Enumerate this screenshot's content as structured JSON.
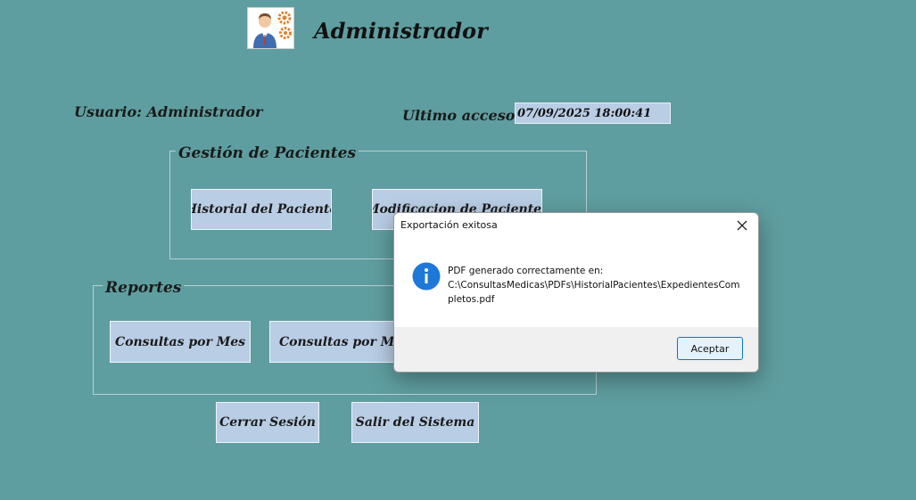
{
  "header": {
    "title": "Administrador",
    "logo_icon": "admin-gears-icon"
  },
  "user": {
    "label": "Usuario: Administrador"
  },
  "access": {
    "label": "Ultimo acceso:",
    "value": "07/09/2025 18:00:41"
  },
  "patients": {
    "legend": "Gestión de Pacientes",
    "history_label": "Historial del Paciente",
    "modify_label": "Modificacion de Pacientes"
  },
  "reports": {
    "legend": "Reportes",
    "by_month_label": "Consultas por Mes",
    "by_doctor_label": "Consultas por Medico"
  },
  "actions": {
    "logout_label": "Cerrar Sesión",
    "exit_label": "Salir del Sistema"
  },
  "dialog": {
    "title": "Exportación exitosa",
    "message_line1": "PDF generado correctamente en:",
    "message_line2": "C:\\ConsultasMedicas\\PDFs\\HistorialPacientes\\ExpedientesCompletos.pdf",
    "ok_label": "Aceptar",
    "icon": "info-icon",
    "accent": "#1e78d7"
  },
  "colors": {
    "background": "#5f9ea0",
    "button": "#b9cde5"
  }
}
